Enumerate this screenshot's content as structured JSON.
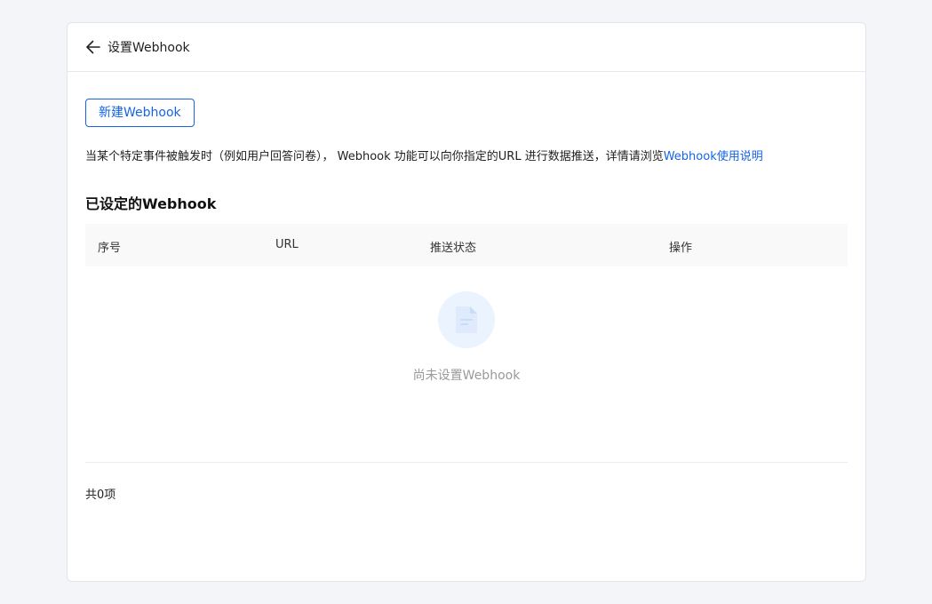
{
  "header": {
    "title": "设置Webhook",
    "back_icon": "arrow-left-icon"
  },
  "actions": {
    "new_label": "新建Webhook"
  },
  "description": {
    "text": "当某个特定事件被触发时（例如用户回答问卷）， Webhook 功能可以向你指定的URL 进行数据推送，详情请浏览",
    "link_text": "Webhook使用说明"
  },
  "section": {
    "title": "已设定的Webhook"
  },
  "table": {
    "columns": [
      "序号",
      "URL",
      "推送状态",
      "操作"
    ],
    "rows": []
  },
  "empty": {
    "icon": "document-icon",
    "text": "尚未设置Webhook"
  },
  "footer": {
    "total": "共0项"
  },
  "colors": {
    "accent": "#1664e6",
    "background": "#f4f5f8",
    "empty_icon_bg": "#ebf3fe"
  }
}
